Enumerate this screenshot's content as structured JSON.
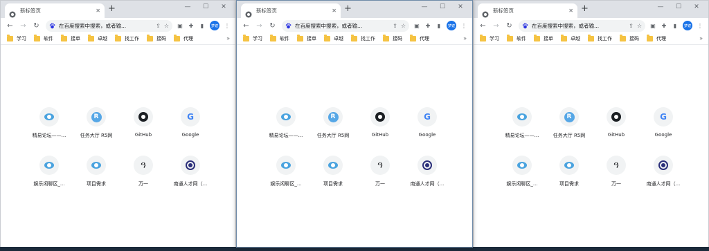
{
  "accent_color": "#1a73e8",
  "tab": {
    "title": "新标签页",
    "favicon": "chrome-icon",
    "close_glyph": "✕"
  },
  "newtab_glyph": "+",
  "window_controls": {
    "minimize": "—",
    "maximize": "☐",
    "close": "✕"
  },
  "nav": {
    "back": "←",
    "forward": "→",
    "reload": "↻"
  },
  "omnibox": {
    "search_engine_icon": "baidu-paw-icon",
    "placeholder": "在百度搜索中搜索，或者输..."
  },
  "toolbar_icons": [
    "share-icon",
    "star-icon",
    "tab-search-icon",
    "extensions-icon",
    "side-panel-icon",
    "more-icon"
  ],
  "profile_label": "梦镜",
  "bookmarks": [
    "学习",
    "软件",
    "接单",
    "卓越",
    "找工作",
    "接码",
    "代理"
  ],
  "bookmarks_more": "»",
  "shortcuts": [
    {
      "label": "精易论坛——...",
      "icon": "jingyi-eye-icon"
    },
    {
      "label": "任务大厅 R5网",
      "icon": "r5-icon"
    },
    {
      "label": "GitHub",
      "icon": "github-icon"
    },
    {
      "label": "Google",
      "icon": "google-icon"
    },
    {
      "label": "娱乐闲聊区_...",
      "icon": "jingyi-eye-icon"
    },
    {
      "label": "项目需求",
      "icon": "jingyi-eye-icon"
    },
    {
      "label": "万一",
      "icon": "wanyi-icon"
    },
    {
      "label": "南通人才网（...",
      "icon": "nantong-icon"
    }
  ]
}
